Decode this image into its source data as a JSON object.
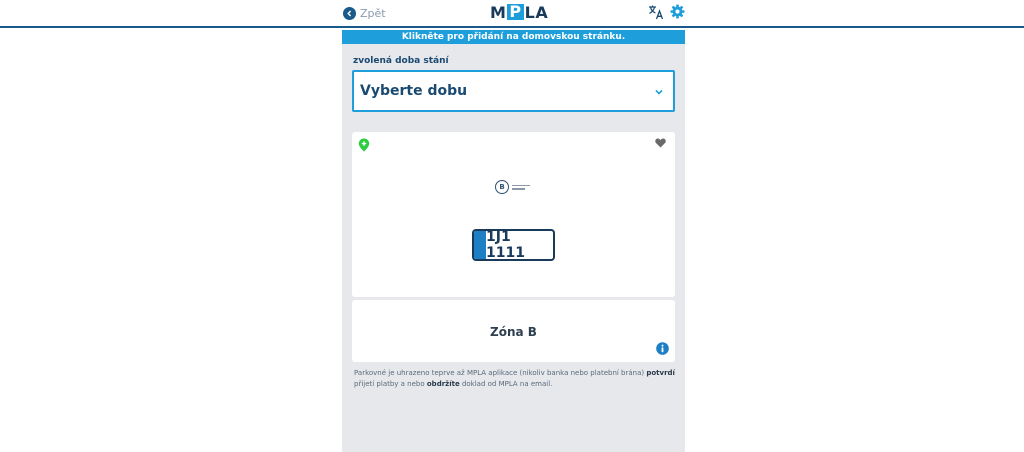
{
  "header": {
    "back_label": "Zpět",
    "logo_left": "M",
    "logo_p": "P",
    "logo_right": "LA",
    "icons": [
      "translate-icon",
      "gear-icon"
    ]
  },
  "banner": {
    "text": "Klikněte pro přidání na domovskou stránku."
  },
  "duration": {
    "label": "zvolená doba stání",
    "placeholder": "Vyberte dobu"
  },
  "parking": {
    "plate": "1J1 1111",
    "zone": "Zóna B",
    "icons": [
      "location-pin-icon",
      "heart-icon",
      "info-icon"
    ]
  },
  "note": {
    "part1": "Parkovné je uhrazeno teprve až MPLA aplikace (nikoliv banka nebo platební brána) ",
    "bold1": "potvrdí",
    "part2": " přijetí platby a nebo ",
    "bold2": "obdržíte",
    "part3": " doklad od MPLA na email."
  },
  "colors": {
    "accent": "#1e9fdc",
    "dark_blue": "#1a4a72",
    "pin_green": "#2ecc40",
    "background": "#e6e8ec"
  }
}
